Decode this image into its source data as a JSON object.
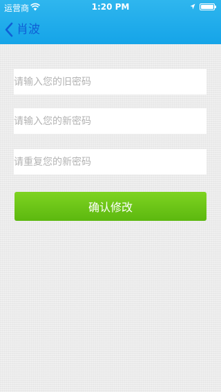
{
  "status_bar": {
    "carrier": "运营商",
    "time": "1:20 PM",
    "battery_level": 1.0
  },
  "nav": {
    "back_label": "肖波"
  },
  "form": {
    "old_password_placeholder": "请输入您的旧密码",
    "new_password_placeholder": "请输入您的新密码",
    "repeat_password_placeholder": "请重复您的新密码",
    "confirm_label": "确认修改"
  },
  "colors": {
    "header": "#1aa7ea",
    "back_label": "#0f5fd6",
    "confirm_button": "#6cc418",
    "background": "#ebebeb"
  },
  "icons": {
    "wifi": "wifi-icon",
    "location": "location-arrow-icon",
    "battery": "battery-icon",
    "back": "chevron-left-icon"
  }
}
